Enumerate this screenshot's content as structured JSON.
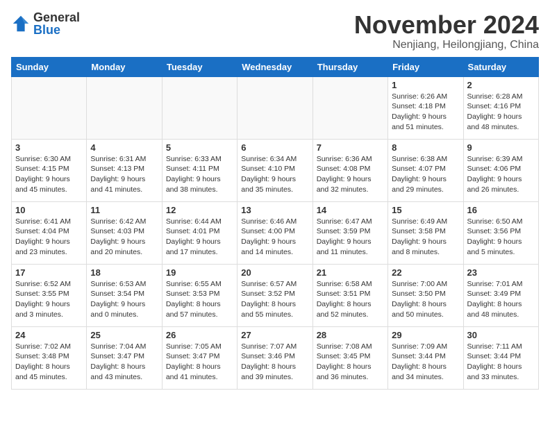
{
  "logo": {
    "general": "General",
    "blue": "Blue"
  },
  "title": "November 2024",
  "location": "Nenjiang, Heilongjiang, China",
  "days_header": [
    "Sunday",
    "Monday",
    "Tuesday",
    "Wednesday",
    "Thursday",
    "Friday",
    "Saturday"
  ],
  "weeks": [
    [
      {
        "day": "",
        "info": ""
      },
      {
        "day": "",
        "info": ""
      },
      {
        "day": "",
        "info": ""
      },
      {
        "day": "",
        "info": ""
      },
      {
        "day": "",
        "info": ""
      },
      {
        "day": "1",
        "info": "Sunrise: 6:26 AM\nSunset: 4:18 PM\nDaylight: 9 hours and 51 minutes."
      },
      {
        "day": "2",
        "info": "Sunrise: 6:28 AM\nSunset: 4:16 PM\nDaylight: 9 hours and 48 minutes."
      }
    ],
    [
      {
        "day": "3",
        "info": "Sunrise: 6:30 AM\nSunset: 4:15 PM\nDaylight: 9 hours and 45 minutes."
      },
      {
        "day": "4",
        "info": "Sunrise: 6:31 AM\nSunset: 4:13 PM\nDaylight: 9 hours and 41 minutes."
      },
      {
        "day": "5",
        "info": "Sunrise: 6:33 AM\nSunset: 4:11 PM\nDaylight: 9 hours and 38 minutes."
      },
      {
        "day": "6",
        "info": "Sunrise: 6:34 AM\nSunset: 4:10 PM\nDaylight: 9 hours and 35 minutes."
      },
      {
        "day": "7",
        "info": "Sunrise: 6:36 AM\nSunset: 4:08 PM\nDaylight: 9 hours and 32 minutes."
      },
      {
        "day": "8",
        "info": "Sunrise: 6:38 AM\nSunset: 4:07 PM\nDaylight: 9 hours and 29 minutes."
      },
      {
        "day": "9",
        "info": "Sunrise: 6:39 AM\nSunset: 4:06 PM\nDaylight: 9 hours and 26 minutes."
      }
    ],
    [
      {
        "day": "10",
        "info": "Sunrise: 6:41 AM\nSunset: 4:04 PM\nDaylight: 9 hours and 23 minutes."
      },
      {
        "day": "11",
        "info": "Sunrise: 6:42 AM\nSunset: 4:03 PM\nDaylight: 9 hours and 20 minutes."
      },
      {
        "day": "12",
        "info": "Sunrise: 6:44 AM\nSunset: 4:01 PM\nDaylight: 9 hours and 17 minutes."
      },
      {
        "day": "13",
        "info": "Sunrise: 6:46 AM\nSunset: 4:00 PM\nDaylight: 9 hours and 14 minutes."
      },
      {
        "day": "14",
        "info": "Sunrise: 6:47 AM\nSunset: 3:59 PM\nDaylight: 9 hours and 11 minutes."
      },
      {
        "day": "15",
        "info": "Sunrise: 6:49 AM\nSunset: 3:58 PM\nDaylight: 9 hours and 8 minutes."
      },
      {
        "day": "16",
        "info": "Sunrise: 6:50 AM\nSunset: 3:56 PM\nDaylight: 9 hours and 5 minutes."
      }
    ],
    [
      {
        "day": "17",
        "info": "Sunrise: 6:52 AM\nSunset: 3:55 PM\nDaylight: 9 hours and 3 minutes."
      },
      {
        "day": "18",
        "info": "Sunrise: 6:53 AM\nSunset: 3:54 PM\nDaylight: 9 hours and 0 minutes."
      },
      {
        "day": "19",
        "info": "Sunrise: 6:55 AM\nSunset: 3:53 PM\nDaylight: 8 hours and 57 minutes."
      },
      {
        "day": "20",
        "info": "Sunrise: 6:57 AM\nSunset: 3:52 PM\nDaylight: 8 hours and 55 minutes."
      },
      {
        "day": "21",
        "info": "Sunrise: 6:58 AM\nSunset: 3:51 PM\nDaylight: 8 hours and 52 minutes."
      },
      {
        "day": "22",
        "info": "Sunrise: 7:00 AM\nSunset: 3:50 PM\nDaylight: 8 hours and 50 minutes."
      },
      {
        "day": "23",
        "info": "Sunrise: 7:01 AM\nSunset: 3:49 PM\nDaylight: 8 hours and 48 minutes."
      }
    ],
    [
      {
        "day": "24",
        "info": "Sunrise: 7:02 AM\nSunset: 3:48 PM\nDaylight: 8 hours and 45 minutes."
      },
      {
        "day": "25",
        "info": "Sunrise: 7:04 AM\nSunset: 3:47 PM\nDaylight: 8 hours and 43 minutes."
      },
      {
        "day": "26",
        "info": "Sunrise: 7:05 AM\nSunset: 3:47 PM\nDaylight: 8 hours and 41 minutes."
      },
      {
        "day": "27",
        "info": "Sunrise: 7:07 AM\nSunset: 3:46 PM\nDaylight: 8 hours and 39 minutes."
      },
      {
        "day": "28",
        "info": "Sunrise: 7:08 AM\nSunset: 3:45 PM\nDaylight: 8 hours and 36 minutes."
      },
      {
        "day": "29",
        "info": "Sunrise: 7:09 AM\nSunset: 3:44 PM\nDaylight: 8 hours and 34 minutes."
      },
      {
        "day": "30",
        "info": "Sunrise: 7:11 AM\nSunset: 3:44 PM\nDaylight: 8 hours and 33 minutes."
      }
    ]
  ]
}
